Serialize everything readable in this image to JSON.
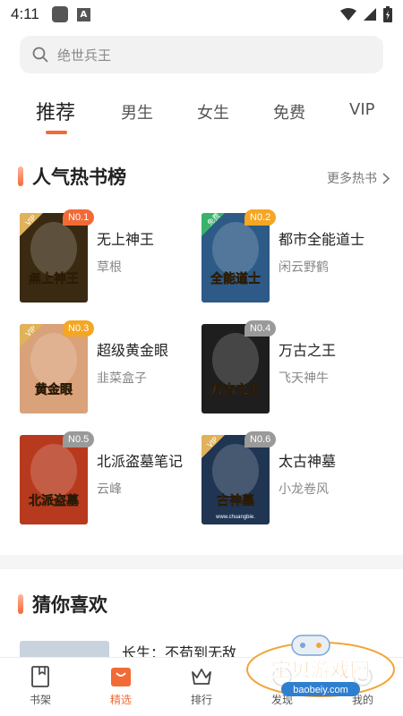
{
  "status_bar": {
    "time": "4:11",
    "a_glyph": "A",
    "icons": [
      "app-icon",
      "a-icon",
      "wifi-icon",
      "signal-icon",
      "battery-icon"
    ]
  },
  "search": {
    "placeholder": "绝世兵王"
  },
  "tabs": [
    {
      "label": "推荐",
      "active": true
    },
    {
      "label": "男生"
    },
    {
      "label": "女生"
    },
    {
      "label": "免费"
    },
    {
      "label": "VIP"
    }
  ],
  "hot_section": {
    "title": "人气热书榜",
    "more_label": "更多热书",
    "books": [
      {
        "rank": "N0.1",
        "title": "无上神王",
        "author": "草根",
        "cover_tag": "VIP",
        "cover_text": "無上神王",
        "badge_color": "#f26a36",
        "cover_color": "#3a2a12"
      },
      {
        "rank": "N0.2",
        "title": "都市全能道士",
        "author": "闲云野鹤",
        "cover_tag": "免费",
        "cover_text": "全能道士",
        "badge_color": "#f5a623",
        "cover_color": "#2d5a86"
      },
      {
        "rank": "N0.3",
        "title": "超级黄金眼",
        "author": "韭菜盒子",
        "cover_tag": "VIP",
        "cover_text": "黄金眼",
        "badge_color": "#f5a623",
        "cover_color": "#d9a27a"
      },
      {
        "rank": "N0.4",
        "title": "万古之王",
        "author": "飞天神牛",
        "cover_tag": "",
        "cover_text": "万古之王",
        "badge_color": "#9a9a9a",
        "cover_color": "#1e1e1e"
      },
      {
        "rank": "N0.5",
        "title": "北派盗墓笔记",
        "author": "云峰",
        "cover_tag": "",
        "cover_text": "北派盗墓",
        "badge_color": "#9a9a9a",
        "cover_color": "#b83a1e"
      },
      {
        "rank": "N0.6",
        "title": "太古神墓",
        "author": "小龙卷风",
        "cover_tag": "VIP",
        "cover_text": "古神墓",
        "cover_url_text": "www.chuangbie.",
        "badge_color": "#9a9a9a",
        "cover_color": "#1f3552"
      }
    ]
  },
  "guess_section": {
    "title": "猜你喜欢",
    "first_item_title": "长生：不苟到无敌"
  },
  "bottom_nav": [
    {
      "label": "书架",
      "icon": "bookshelf-icon"
    },
    {
      "label": "精选",
      "icon": "featured-bag-icon",
      "active": true
    },
    {
      "label": "排行",
      "icon": "crown-icon"
    },
    {
      "label": "发现",
      "icon": "discover-icon"
    },
    {
      "label": "我的",
      "icon": "profile-icon"
    }
  ],
  "watermark": {
    "name": "宝贝游戏网",
    "url": "baobeiy.com"
  },
  "colors": {
    "accent": "#f26a36",
    "search_bg": "#f2f2f2",
    "divider": "#f5f5f5"
  }
}
